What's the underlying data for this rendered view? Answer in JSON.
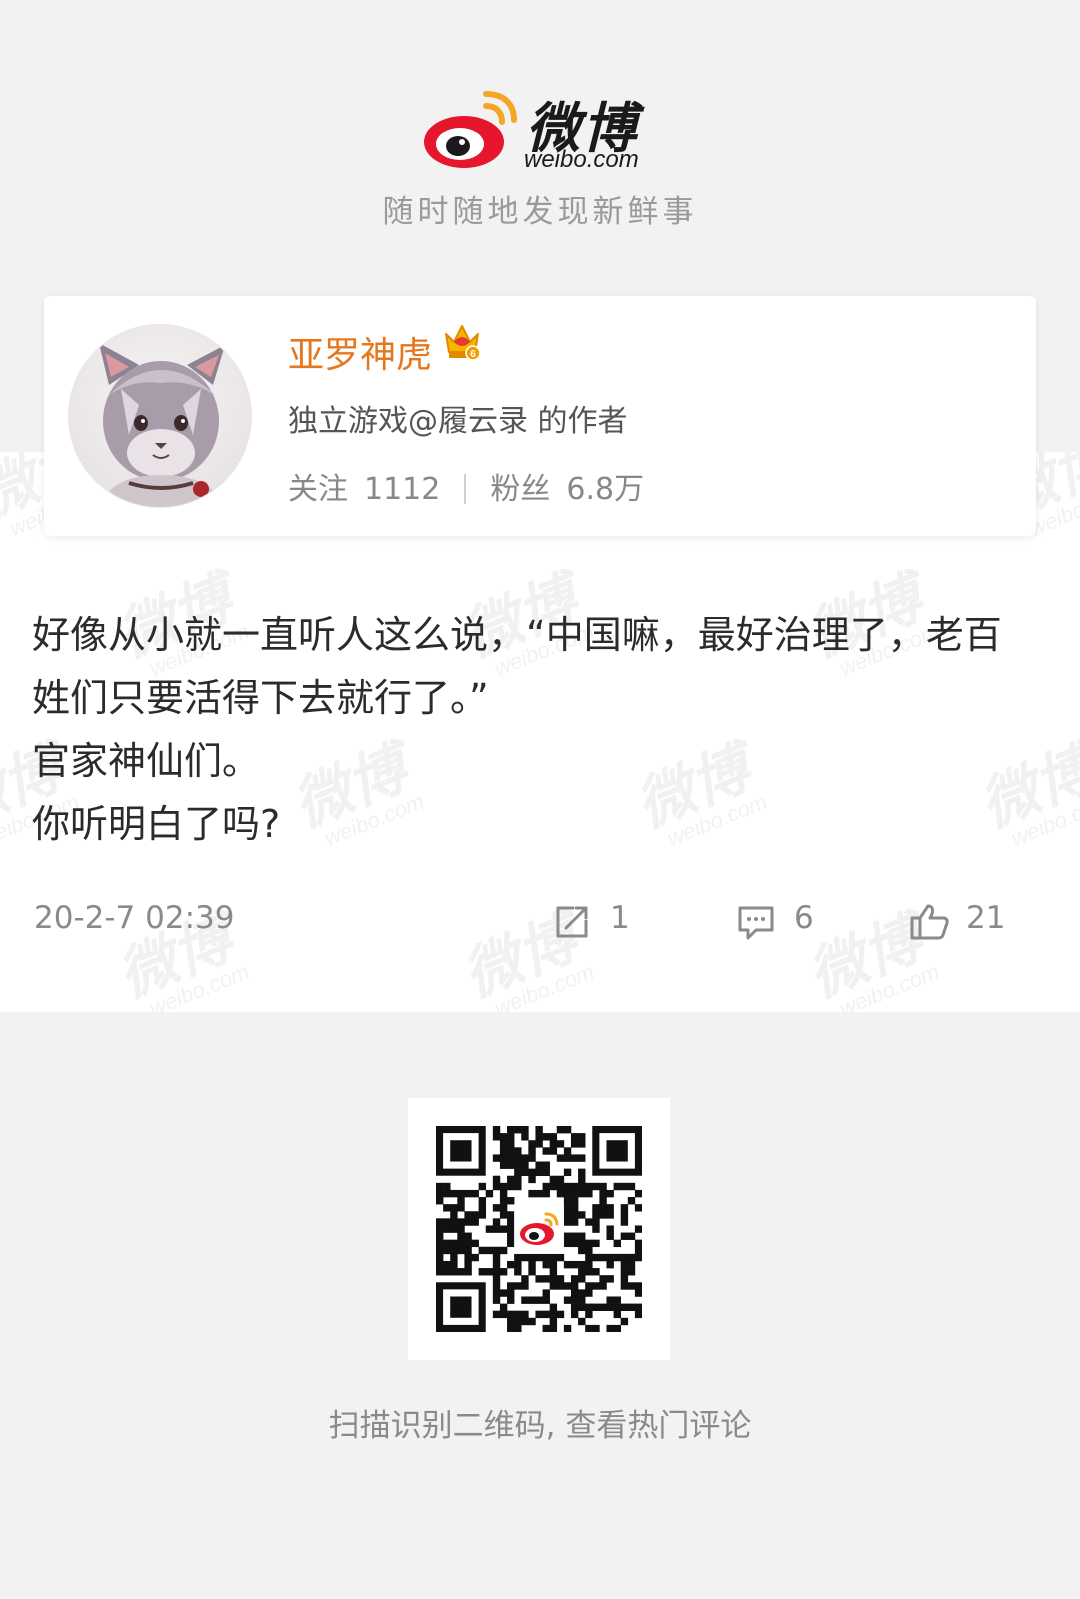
{
  "header": {
    "logo_cn": "微博",
    "logo_en": "weibo.com",
    "tagline": "随时随地发现新鲜事"
  },
  "author": {
    "name": "亚罗神虎",
    "description": "独立游戏@履云录 的作者",
    "following_label": "关注",
    "following_count": "1112",
    "followers_label": "粉丝",
    "followers_count": "6.8万",
    "vip_level": "6"
  },
  "post": {
    "lines": [
      "好像从小就一直听人这么说，“中国嘛，最好治理了，老百",
      "姓们只要活得下去就行了。”",
      "官家神仙们。",
      "你听明白了吗?"
    ],
    "timestamp": "20-2-7 02:39",
    "repost_count": "1",
    "comment_count": "6",
    "like_count": "21"
  },
  "watermark": {
    "cn": "微博",
    "en": "weibo.com"
  },
  "qr": {
    "caption": "扫描识别二维码, 查看热门评论"
  },
  "colors": {
    "brand_red": "#e6162d",
    "brand_orange": "#ff9933",
    "name_orange": "#e5781e",
    "background": "#f2f2f2"
  }
}
